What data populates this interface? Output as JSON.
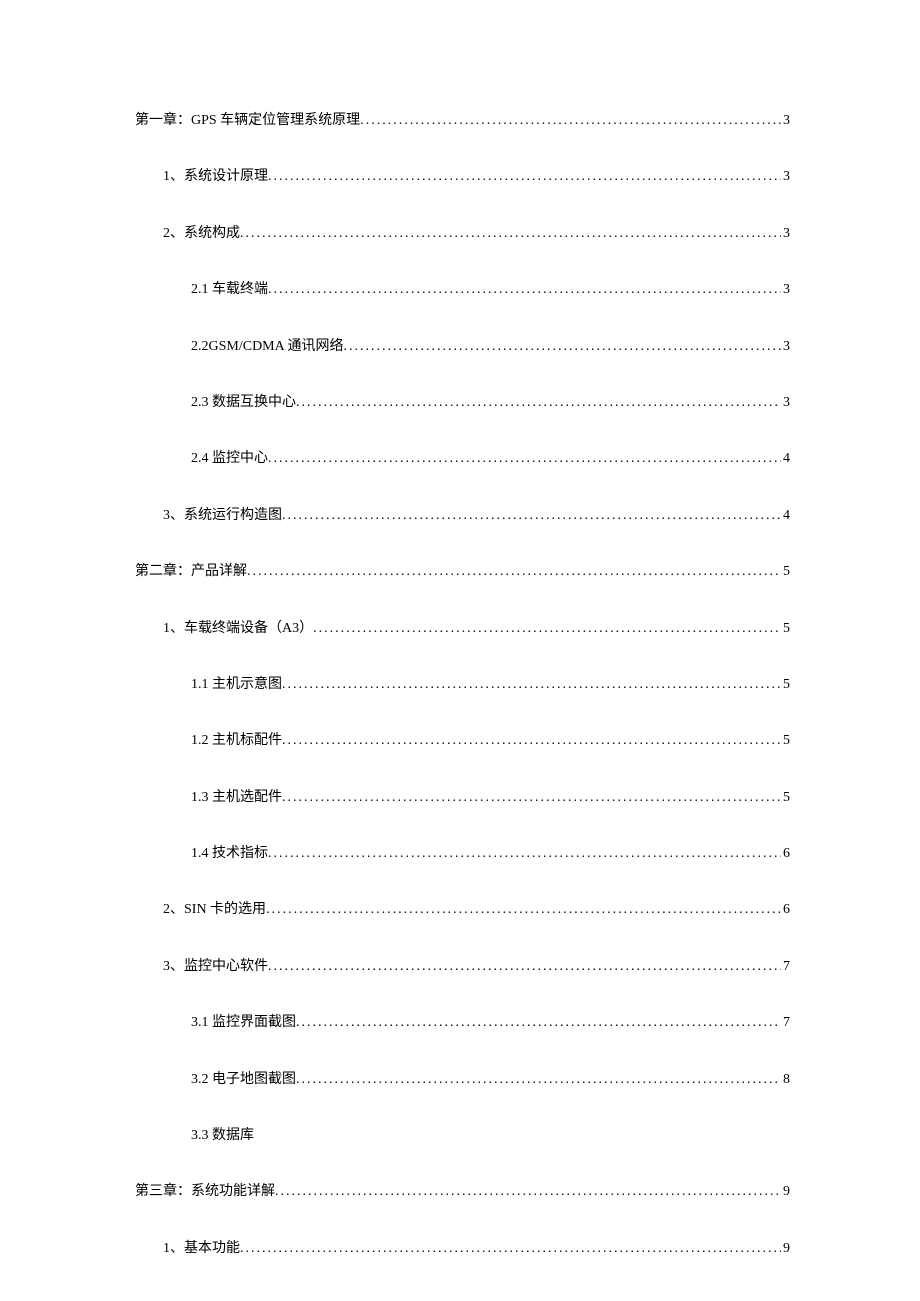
{
  "toc": [
    {
      "level": 0,
      "title": "第一章：GPS 车辆定位管理系统原理",
      "page": "3"
    },
    {
      "level": 1,
      "title": "1、系统设计原理",
      "page": "3"
    },
    {
      "level": 1,
      "title": "2、系统构成",
      "page": "3"
    },
    {
      "level": 2,
      "title": "2.1 车载终端",
      "page": "3"
    },
    {
      "level": 2,
      "title": "2.2GSM/CDMA 通讯网络",
      "page": "3"
    },
    {
      "level": 2,
      "title": "2.3 数据互换中心",
      "page": "3"
    },
    {
      "level": 2,
      "title": "2.4 监控中心",
      "page": "4"
    },
    {
      "level": 1,
      "title": "3、系统运行构造图",
      "page": "4"
    },
    {
      "level": 0,
      "title": "第二章：产品详解",
      "page": "5"
    },
    {
      "level": 1,
      "title": "1、车载终端设备（A3）",
      "page": "5"
    },
    {
      "level": 2,
      "title": "1.1 主机示意图",
      "page": "5"
    },
    {
      "level": 2,
      "title": "1.2 主机标配件",
      "page": "5"
    },
    {
      "level": 2,
      "title": "1.3 主机选配件",
      "page": "5"
    },
    {
      "level": 2,
      "title": "1.4 技术指标",
      "page": "6"
    },
    {
      "level": 1,
      "title": "2、SIN 卡的选用",
      "page": "6"
    },
    {
      "level": 1,
      "title": "3、监控中心软件",
      "page": "7"
    },
    {
      "level": 2,
      "title": "3.1  监控界面截图",
      "page": "7"
    },
    {
      "level": 2,
      "title": "3.2  电子地图截图",
      "page": "8"
    },
    {
      "level": 2,
      "title": "3.3 数据库",
      "page": ""
    },
    {
      "level": 0,
      "title": "第三章：系统功能详解",
      "page": "9"
    },
    {
      "level": 1,
      "title": "1、基本功能",
      "page": "9"
    }
  ]
}
